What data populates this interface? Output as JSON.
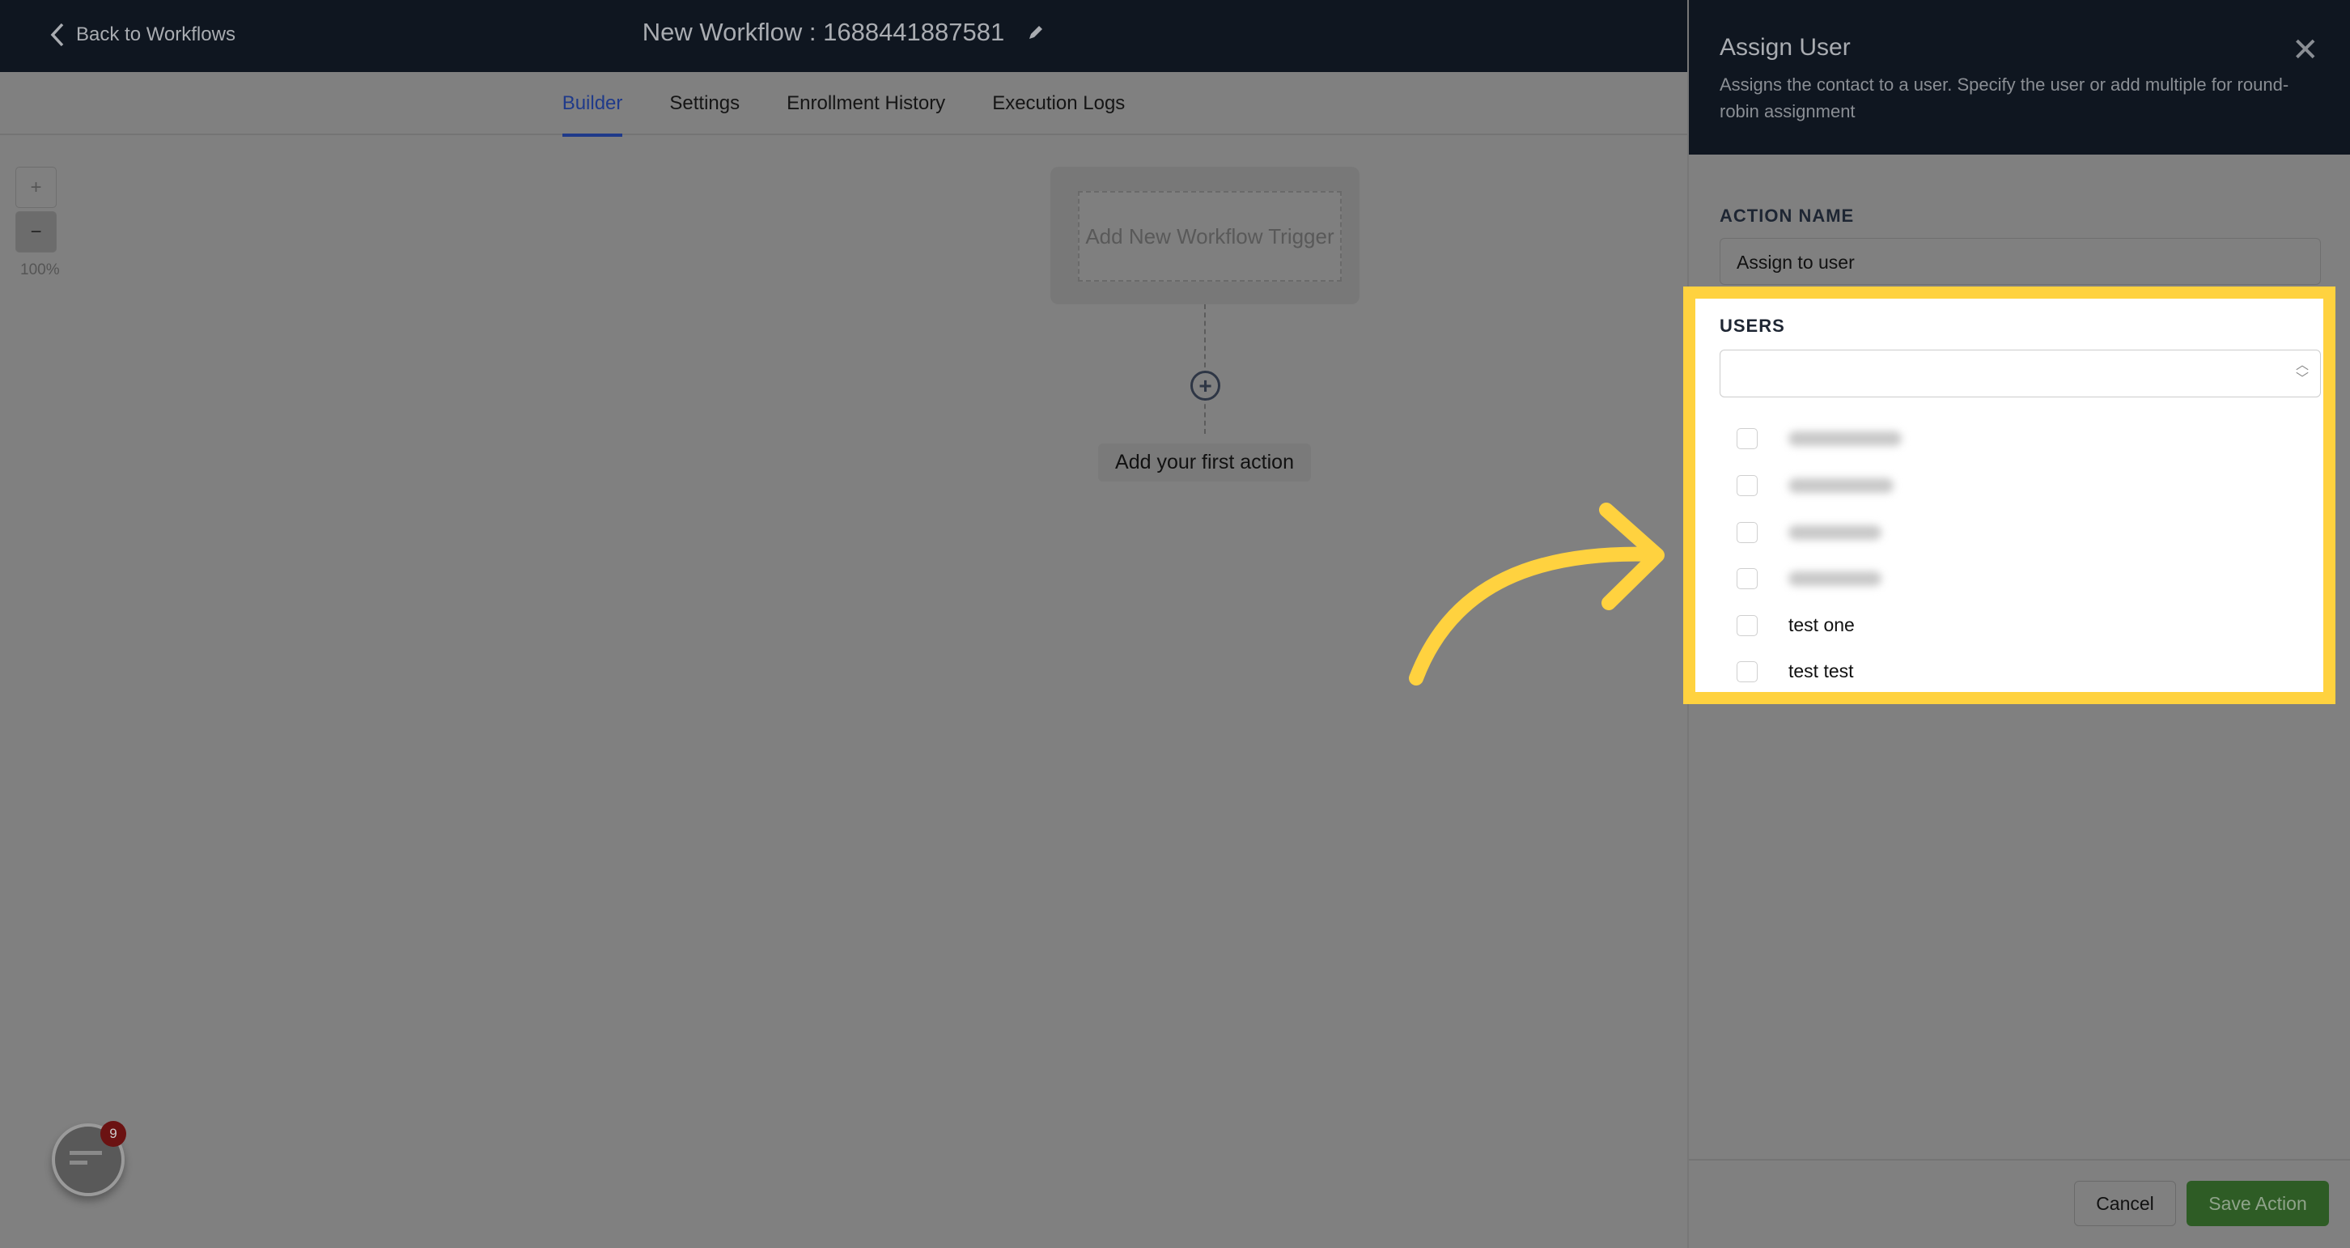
{
  "header": {
    "back_label": "Back to Workflows",
    "title": "New Workflow : 1688441887581"
  },
  "tabs": [
    {
      "label": "Builder",
      "active": true
    },
    {
      "label": "Settings"
    },
    {
      "label": "Enrollment History"
    },
    {
      "label": "Execution Logs"
    }
  ],
  "canvas": {
    "zoom_in": "+",
    "zoom_out": "−",
    "zoom_level": "100%",
    "trigger_label": "Add New Workflow Trigger",
    "first_action_label": "Add your first action"
  },
  "chat_widget": {
    "badge_count": "9"
  },
  "panel": {
    "title": "Assign User",
    "description": "Assigns the contact to a user. Specify the user or add multiple for round-robin assignment",
    "action_name_label": "ACTION NAME",
    "action_name_value": "Assign to user",
    "users_label": "USERS",
    "users_value": "",
    "user_options": [
      {
        "label": null,
        "blurred": true,
        "checked": false
      },
      {
        "label": null,
        "blurred": true,
        "checked": false
      },
      {
        "label": null,
        "blurred": true,
        "checked": false
      },
      {
        "label": null,
        "blurred": true,
        "checked": false
      },
      {
        "label": "test one",
        "checked": false
      },
      {
        "label": "test test",
        "checked": false
      }
    ],
    "cancel_label": "Cancel",
    "save_label": "Save Action"
  },
  "colors": {
    "highlight": "#ffd23f",
    "header_bg": "#0f1620",
    "active_tab": "#1f3a8a",
    "save_button": "#2e5c25"
  }
}
